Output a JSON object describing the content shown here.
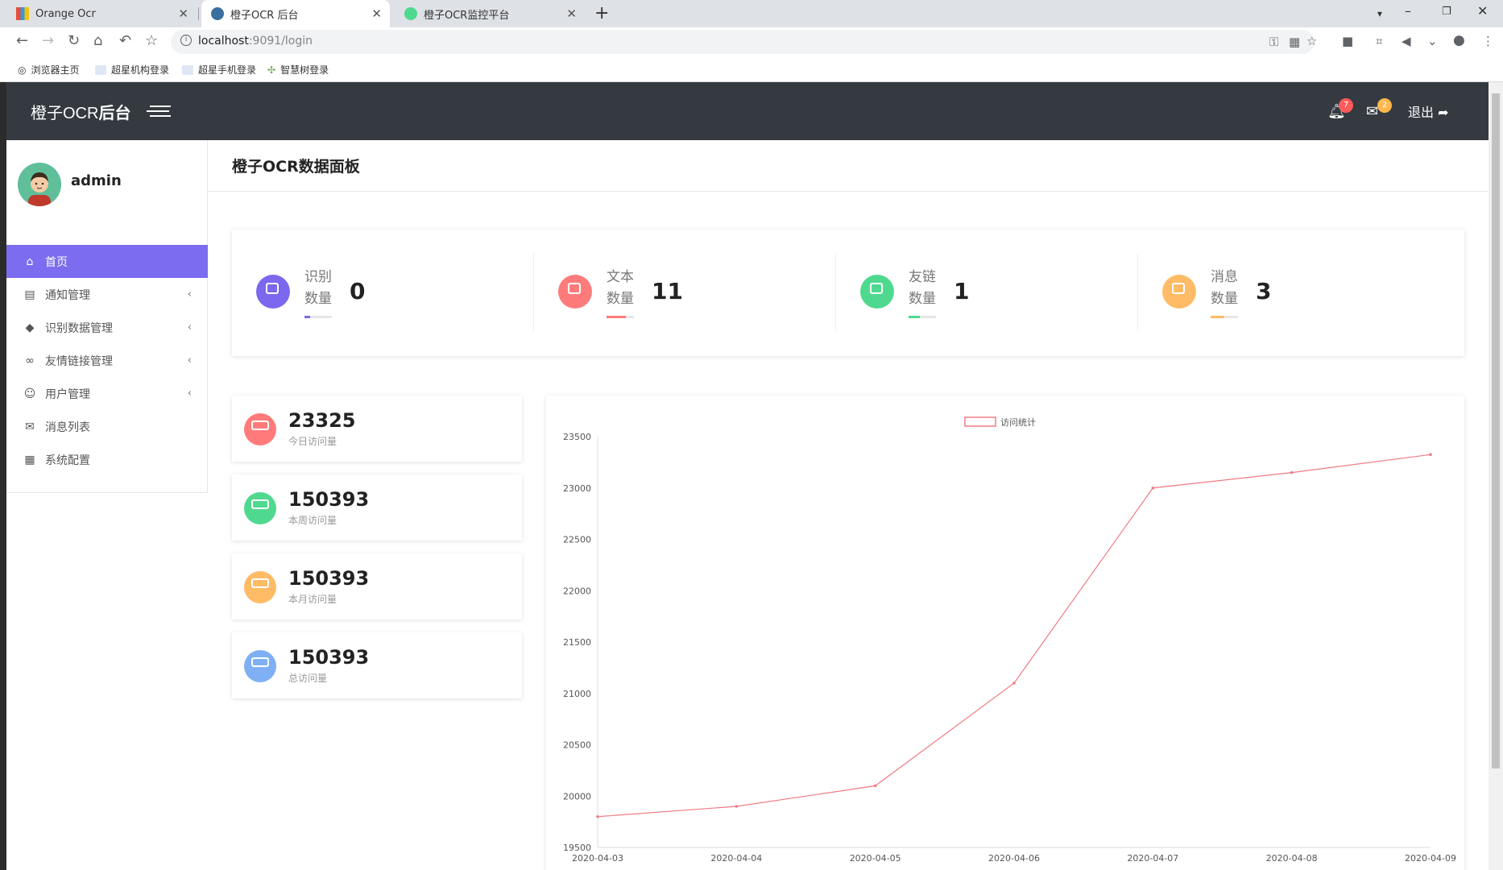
{
  "browser": {
    "tabs": [
      {
        "title": "Orange Ocr"
      },
      {
        "title": "橙子OCR 后台"
      },
      {
        "title": "橙子OCR监控平台"
      }
    ],
    "url_host": "localhost",
    "url_rest": ":9091/login",
    "bookmarks": [
      "浏览器主页",
      "超星机构登录",
      "超星手机登录",
      "智慧树登录"
    ]
  },
  "header": {
    "brand_prefix": "橙子OCR",
    "brand_suffix": "后台",
    "notif_count": "7",
    "mail_count": "2",
    "logout": "退出"
  },
  "sidebar": {
    "username": "admin",
    "items": [
      {
        "label": "首页",
        "icon": "home-icon"
      },
      {
        "label": "通知管理",
        "icon": "book-icon"
      },
      {
        "label": "识别数据管理",
        "icon": "tag-icon"
      },
      {
        "label": "友情链接管理",
        "icon": "link-icon"
      },
      {
        "label": "用户管理",
        "icon": "user-icon"
      },
      {
        "label": "消息列表",
        "icon": "envelope-icon"
      },
      {
        "label": "系统配置",
        "icon": "newspaper-icon"
      }
    ]
  },
  "main": {
    "title": "橙子OCR数据面板",
    "stats": [
      {
        "label1": "识别",
        "label2": "数量",
        "value": "0",
        "color": "#7b68ee",
        "progress": 0.2
      },
      {
        "label1": "文本",
        "label2": "数量",
        "value": "11",
        "color": "#ff7b7b",
        "progress": 0.7
      },
      {
        "label1": "友链",
        "label2": "数量",
        "value": "1",
        "color": "#4fd98f",
        "progress": 0.4
      },
      {
        "label1": "消息",
        "label2": "数量",
        "value": "3",
        "color": "#ffbb66",
        "progress": 0.5
      }
    ],
    "visits": [
      {
        "value": "23325",
        "label": "今日访问量",
        "color": "#ff7b7b"
      },
      {
        "value": "150393",
        "label": "本周访问量",
        "color": "#4fd98f"
      },
      {
        "value": "150393",
        "label": "本月访问量",
        "color": "#ffbb66"
      },
      {
        "value": "150393",
        "label": "总访问量",
        "color": "#7fb0f5"
      }
    ]
  },
  "chart_data": {
    "type": "line",
    "series": [
      {
        "name": "访问统计",
        "values": [
          19800,
          19900,
          20100,
          21100,
          23000,
          23150,
          23325
        ]
      }
    ],
    "x": [
      "2020-04-03",
      "2020-04-04",
      "2020-04-05",
      "2020-04-06",
      "2020-04-07",
      "2020-04-08",
      "2020-04-09"
    ],
    "yticks": [
      19500,
      20000,
      20500,
      21000,
      21500,
      22000,
      22500,
      23000,
      23500
    ],
    "ylim": [
      19500,
      23500
    ],
    "color": "#f07c85",
    "legend_position": "top-center",
    "grid": false
  }
}
